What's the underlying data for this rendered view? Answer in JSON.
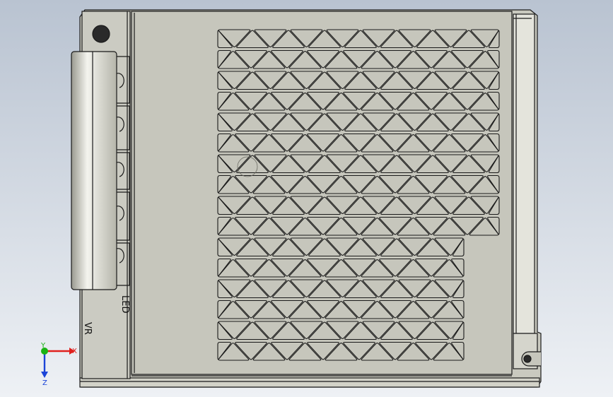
{
  "colors": {
    "bg_top": "#b9c3d1",
    "bg_bottom": "#eef1f5",
    "body_fill": "#c9c9bf",
    "panel_fill": "#c6c6bc",
    "edge": "#1a1a1a",
    "side_fill": "#e4e4dc",
    "axis_x": "#e0201e",
    "axis_y": "#19b313",
    "axis_z": "#1b44d8"
  },
  "labels": {
    "led": "LED",
    "vr": "VR"
  },
  "triad": {
    "x": "X",
    "y": "Y",
    "z": "Z"
  }
}
